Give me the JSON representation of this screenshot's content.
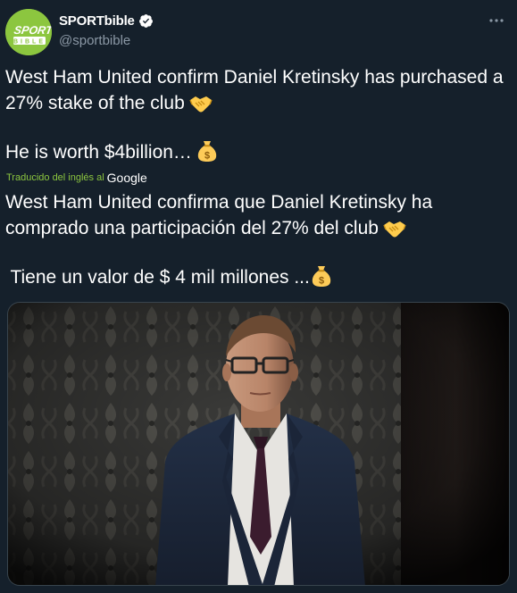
{
  "account": {
    "display_name": "SPORTbible",
    "handle": "@sportbible",
    "avatar_logo_text_top": "SPORT",
    "avatar_logo_text_bottom": "BIBLE",
    "avatar_color": "#8cc63f"
  },
  "tweet": {
    "line1": "West Ham United confirm Daniel Kretinsky has purchased a 27% stake of the club",
    "line2": "He is worth $4billion…"
  },
  "translation": {
    "label": "Traducido del inglés al",
    "provider": "Google",
    "line1": "West Ham United confirma que Daniel Kretinsky ha comprado una participación del 27% del club",
    "line2": " Tiene un valor de $ 4 mil millones ..."
  },
  "icons": {
    "verified": "verified-badge-icon",
    "more": "more-options-icon",
    "handshake": "handshake-emoji",
    "money_bag": "money-bag-emoji"
  },
  "colors": {
    "background": "#15202b",
    "text": "#ffffff",
    "secondary_text": "#8b98a5",
    "verified": "#1d9bf0",
    "translation_label": "#8cc63f"
  }
}
